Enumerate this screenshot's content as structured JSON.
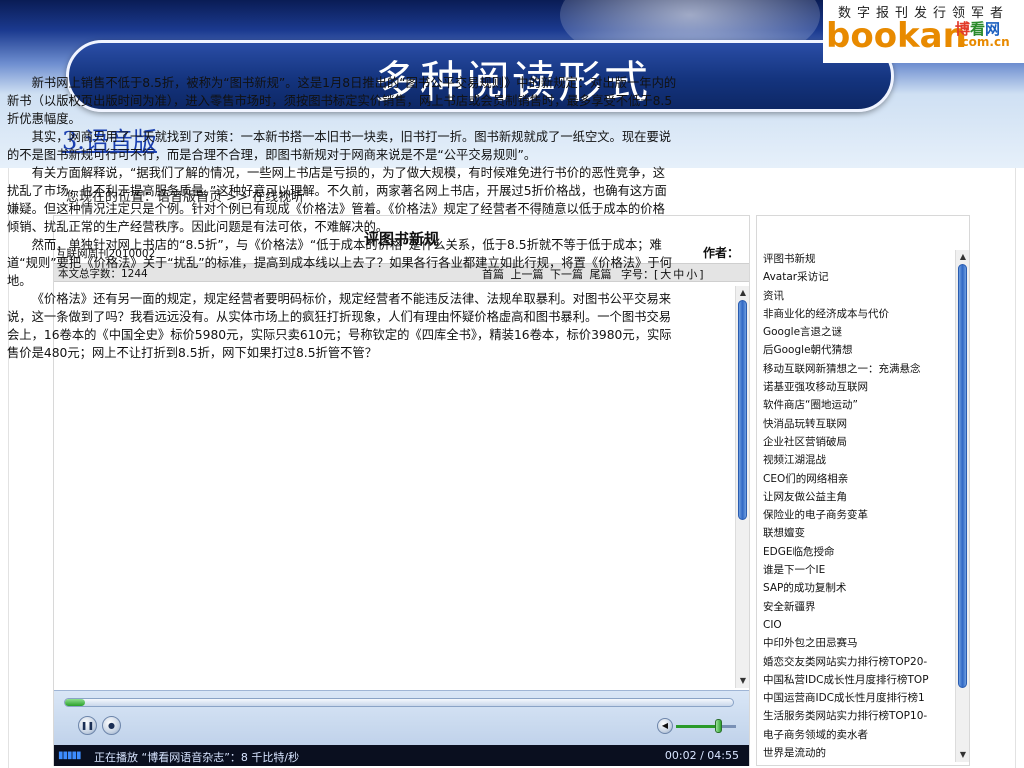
{
  "slide": {
    "title": "多种阅读形式",
    "subtitle": "3.语音版"
  },
  "logo": {
    "tagline": "数字报刊发行领军者",
    "brand": "bookan",
    "cn1": "博",
    "cn2": "看",
    "cn3": "网",
    "domain": ".com.cn"
  },
  "location": {
    "prefix": "您现在的位置：",
    "home": "语音版首页",
    "sep": ">>",
    "current": "在线视听"
  },
  "article": {
    "title": "评图书新规",
    "issue": "互联网周刊2010002",
    "author_label": "作者：",
    "word_count": "本文总字数：1244",
    "nav": {
      "first": "首篇",
      "prev": "上一篇",
      "next": "下一篇",
      "last": "尾篇"
    },
    "font_size": {
      "label": "字号：[",
      "large": "大",
      "medium": "中",
      "small": "小",
      "close": "]"
    },
    "paragraphs": [
      "新书网上销售不低于8.5折，被称为“图书新规”。这是1月8日推出的“图书公平交易规则》中的新规定：对出版一年内的新书（以版权页出版时间为准），进入零售市场时，须按图书标定实价销售，网上书店或会员制销售时，最多享受不低于8.5折优惠幅度。",
      "其实，网商只用了一天就找到了对策：一本新书搭一本旧书一块卖，旧书打一折。图书新规就成了一纸空文。现在要说的不是图书新规可行可不行，而是合理不合理，即图书新规对于网商来说是不是“公平交易规则”。",
      "有关方面解释说，“据我们了解的情况，一些网上书店是亏损的，为了做大规模，有时候难免进行书价的恶性竞争，这扰乱了市场，也不利于提高服务质量。”这种好意可以理解。不久前，两家著名网上书店，开展过5折价格战，也确有这方面嫌疑。但这种情况注定只是个例。针对个例已有现成《价格法》管着。《价格法》规定了经营者不得随意以低于成本的价格倾销、扰乱正常的生产经营秩序。因此问题是有法可依，不难解决的。",
      "然而，单独针对网上书店的“8.5折”，与《价格法》“低于成本的价格”是什么关系，低于8.5折就不等于低于成本；难道“规则”要把《价格法》关于“扰乱”的标准，提高到成本线以上去了？如果各行各业都建立如此行规，将置《价格法》于何地。",
      "《价格法》还有另一面的规定，规定经营者要明码标价，规定经营者不能违反法律、法规牟取暴利。对图书公平交易来说，这一条做到了吗？我看远远没有。从实体市场上的疯狂打折现象，人们有理由怀疑价格虚高和图书暴利。一个图书交易会上，16卷本的《中国全史》标价5980元，实际只卖610元；号称钦定的《四库全书》，精装16卷本，标价3980元，实际售价是480元；网上不让打折到8.5折，网下如果打过8.5折管不管？"
    ]
  },
  "player": {
    "progress": 0.03,
    "volume": 0.72,
    "pause_glyph": "❚❚",
    "stop_glyph": "●",
    "volume_glyph": "◀",
    "eq_glyph": "▮▮▮▮▮",
    "now_playing": "正在播放 “博看网语音杂志”：8 千比特/秒",
    "time": "00:02 / 04:55"
  },
  "scroll": {
    "up": "▲",
    "down": "▼"
  },
  "sidebar": {
    "items": [
      "评图书新规",
      "Avatar采访记",
      "资讯",
      "非商业化的经济成本与代价",
      "Google言退之谜",
      "后Google朝代猜想",
      "移动互联网新猜想之一：充满悬念",
      "诺基亚强攻移动互联网",
      "软件商店“圈地运动”",
      "快消品玩转互联网",
      "企业社区营销破局",
      "视频江湖混战",
      "CEO们的网络相亲",
      "让网友做公益主角",
      "保险业的电子商务变革",
      "联想嬗变",
      "EDGE临危授命",
      "谁是下一个IE",
      "SAP的成功复制术",
      "安全新疆界",
      "CIO",
      "中印外包之田忌赛马",
      "婚恋交友类网站实力排行榜TOP20-",
      "中国私营IDC成长性月度排行榜TOP",
      "中国运营商IDC成长性月度排行榜1",
      "生活服务类网站实力排行榜TOP10-",
      "电子商务领域的卖水者",
      "世界是流动的"
    ]
  }
}
